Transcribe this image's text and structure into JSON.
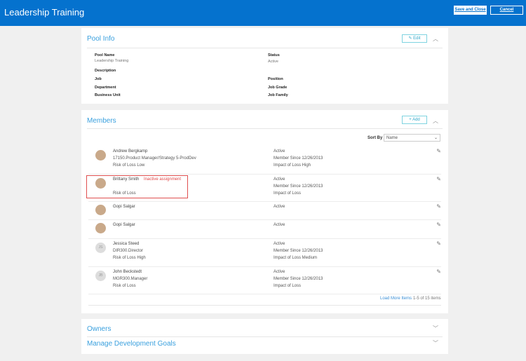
{
  "header": {
    "title": "Leadership Training",
    "save_close": "Save and Close",
    "cancel": "Cancel"
  },
  "pool_info": {
    "title": "Pool Info",
    "edit": "Edit",
    "fields": {
      "pool_name_label": "Pool Name",
      "pool_name": "Leadership Training",
      "status_label": "Status",
      "status": "Active",
      "description_label": "Description",
      "job_label": "Job",
      "position_label": "Position",
      "department_label": "Department",
      "job_grade_label": "Job Grade",
      "business_unit_label": "Business Unit",
      "job_family_label": "Job Family"
    }
  },
  "members": {
    "title": "Members",
    "add": "Add",
    "sort_by_label": "Sort By",
    "sort_by_value": "Name",
    "rows": [
      {
        "name": "Andrew Bergkamp",
        "line2": "17150.Product Manager/Strategy 5-ProdDev",
        "risk": "Risk of Loss  Low",
        "status": "Active",
        "since": "Member Since  12/26/2013",
        "impact": "Impact of Loss  High"
      },
      {
        "name": "Brittany Smith",
        "tag": "Inactive assignment",
        "risk": "Risk of Loss",
        "status": "Active",
        "since": "Member Since  12/26/2013",
        "impact": "Impact of Loss"
      },
      {
        "name": "Gopi Salgar",
        "status": "Active"
      },
      {
        "name": "Gopi Salgar",
        "status": "Active"
      },
      {
        "initials": "JS",
        "name": "Jessica Steed",
        "line2": "DIR300.Director",
        "risk": "Risk of Loss  High",
        "status": "Active",
        "since": "Member Since  12/26/2013",
        "impact": "Impact of Loss  Medium"
      },
      {
        "initials": "JB",
        "name": "John Beckstedt",
        "line2": "MGR300.Manager",
        "risk": "Risk of Loss",
        "status": "Active",
        "since": "Member Since  12/26/2013",
        "impact": "Impact of Loss"
      }
    ],
    "load_more": "Load More Items",
    "count": "1-5 of 15 items"
  },
  "owners": {
    "title": "Owners"
  },
  "goals": {
    "title": "Manage Development Goals"
  }
}
